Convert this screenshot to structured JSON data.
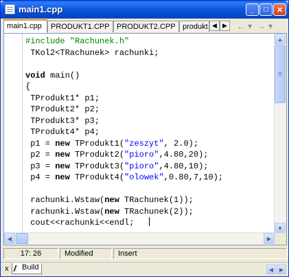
{
  "window": {
    "title": "main1.cpp",
    "minimize_icon": "minimize-icon",
    "maximize_icon": "maximize-icon",
    "close_icon": "close-icon"
  },
  "tabs": [
    {
      "label": "main1.cpp",
      "active": true
    },
    {
      "label": "PRODUKT1.CPP",
      "active": false
    },
    {
      "label": "PRODUKT2.CPP",
      "active": false
    },
    {
      "label": "produkt",
      "active": false
    }
  ],
  "tab_scroll": {
    "left": "◀",
    "right": "▶"
  },
  "nav": {
    "back": "←",
    "forward": "→",
    "dropdown": "▾"
  },
  "code_lines": [
    {
      "parts": [
        {
          "t": "#include \"Rachunek.h\"",
          "c": "pre"
        }
      ]
    },
    {
      "parts": [
        {
          "t": " TKol2<TRachunek> rachunki;",
          "c": ""
        }
      ]
    },
    {
      "parts": [
        {
          "t": "",
          "c": ""
        }
      ]
    },
    {
      "parts": [
        {
          "t": "void",
          "c": "kw"
        },
        {
          "t": " main()",
          "c": ""
        }
      ]
    },
    {
      "parts": [
        {
          "t": "{",
          "c": ""
        }
      ]
    },
    {
      "parts": [
        {
          "t": " TProdukt1* p1;",
          "c": ""
        }
      ]
    },
    {
      "parts": [
        {
          "t": " TProdukt2* p2;",
          "c": ""
        }
      ]
    },
    {
      "parts": [
        {
          "t": " TProdukt3* p3;",
          "c": ""
        }
      ]
    },
    {
      "parts": [
        {
          "t": " TProdukt4* p4;",
          "c": ""
        }
      ]
    },
    {
      "parts": [
        {
          "t": " p1 = ",
          "c": ""
        },
        {
          "t": "new",
          "c": "kw"
        },
        {
          "t": " TProdukt1(",
          "c": ""
        },
        {
          "t": "\"zeszyt\"",
          "c": "str"
        },
        {
          "t": ", 2.0);",
          "c": ""
        }
      ]
    },
    {
      "parts": [
        {
          "t": " p2 = ",
          "c": ""
        },
        {
          "t": "new",
          "c": "kw"
        },
        {
          "t": " TProdukt2(",
          "c": ""
        },
        {
          "t": "\"pioro\"",
          "c": "str"
        },
        {
          "t": ",4.80,20);",
          "c": ""
        }
      ]
    },
    {
      "parts": [
        {
          "t": " p3 = ",
          "c": ""
        },
        {
          "t": "new",
          "c": "kw"
        },
        {
          "t": " TProdukt3(",
          "c": ""
        },
        {
          "t": "\"pioro\"",
          "c": "str"
        },
        {
          "t": ",4.80,10);",
          "c": ""
        }
      ]
    },
    {
      "parts": [
        {
          "t": " p4 = ",
          "c": ""
        },
        {
          "t": "new",
          "c": "kw"
        },
        {
          "t": " TProdukt4(",
          "c": ""
        },
        {
          "t": "\"olowek\"",
          "c": "str"
        },
        {
          "t": ",0.80,7,10);",
          "c": ""
        }
      ]
    },
    {
      "parts": [
        {
          "t": "",
          "c": ""
        }
      ]
    },
    {
      "parts": [
        {
          "t": " rachunki.Wstaw(",
          "c": ""
        },
        {
          "t": "new",
          "c": "kw"
        },
        {
          "t": " TRachunek(1));",
          "c": ""
        }
      ]
    },
    {
      "parts": [
        {
          "t": " rachunki.Wstaw(",
          "c": ""
        },
        {
          "t": "new",
          "c": "kw"
        },
        {
          "t": " TRachunek(2));",
          "c": ""
        }
      ]
    },
    {
      "parts": [
        {
          "t": " cout<<rachunki<<endl;",
          "c": ""
        }
      ],
      "caret": true
    }
  ],
  "colors": {
    "keyword": "#000000",
    "string": "#0000ff",
    "preprocessor": "#008000",
    "titlebar": "#0a56e0"
  },
  "status": {
    "position": "17: 26",
    "modified": "Modified",
    "mode": "Insert"
  },
  "bottom": {
    "close": "x",
    "tab_label": "Build"
  }
}
